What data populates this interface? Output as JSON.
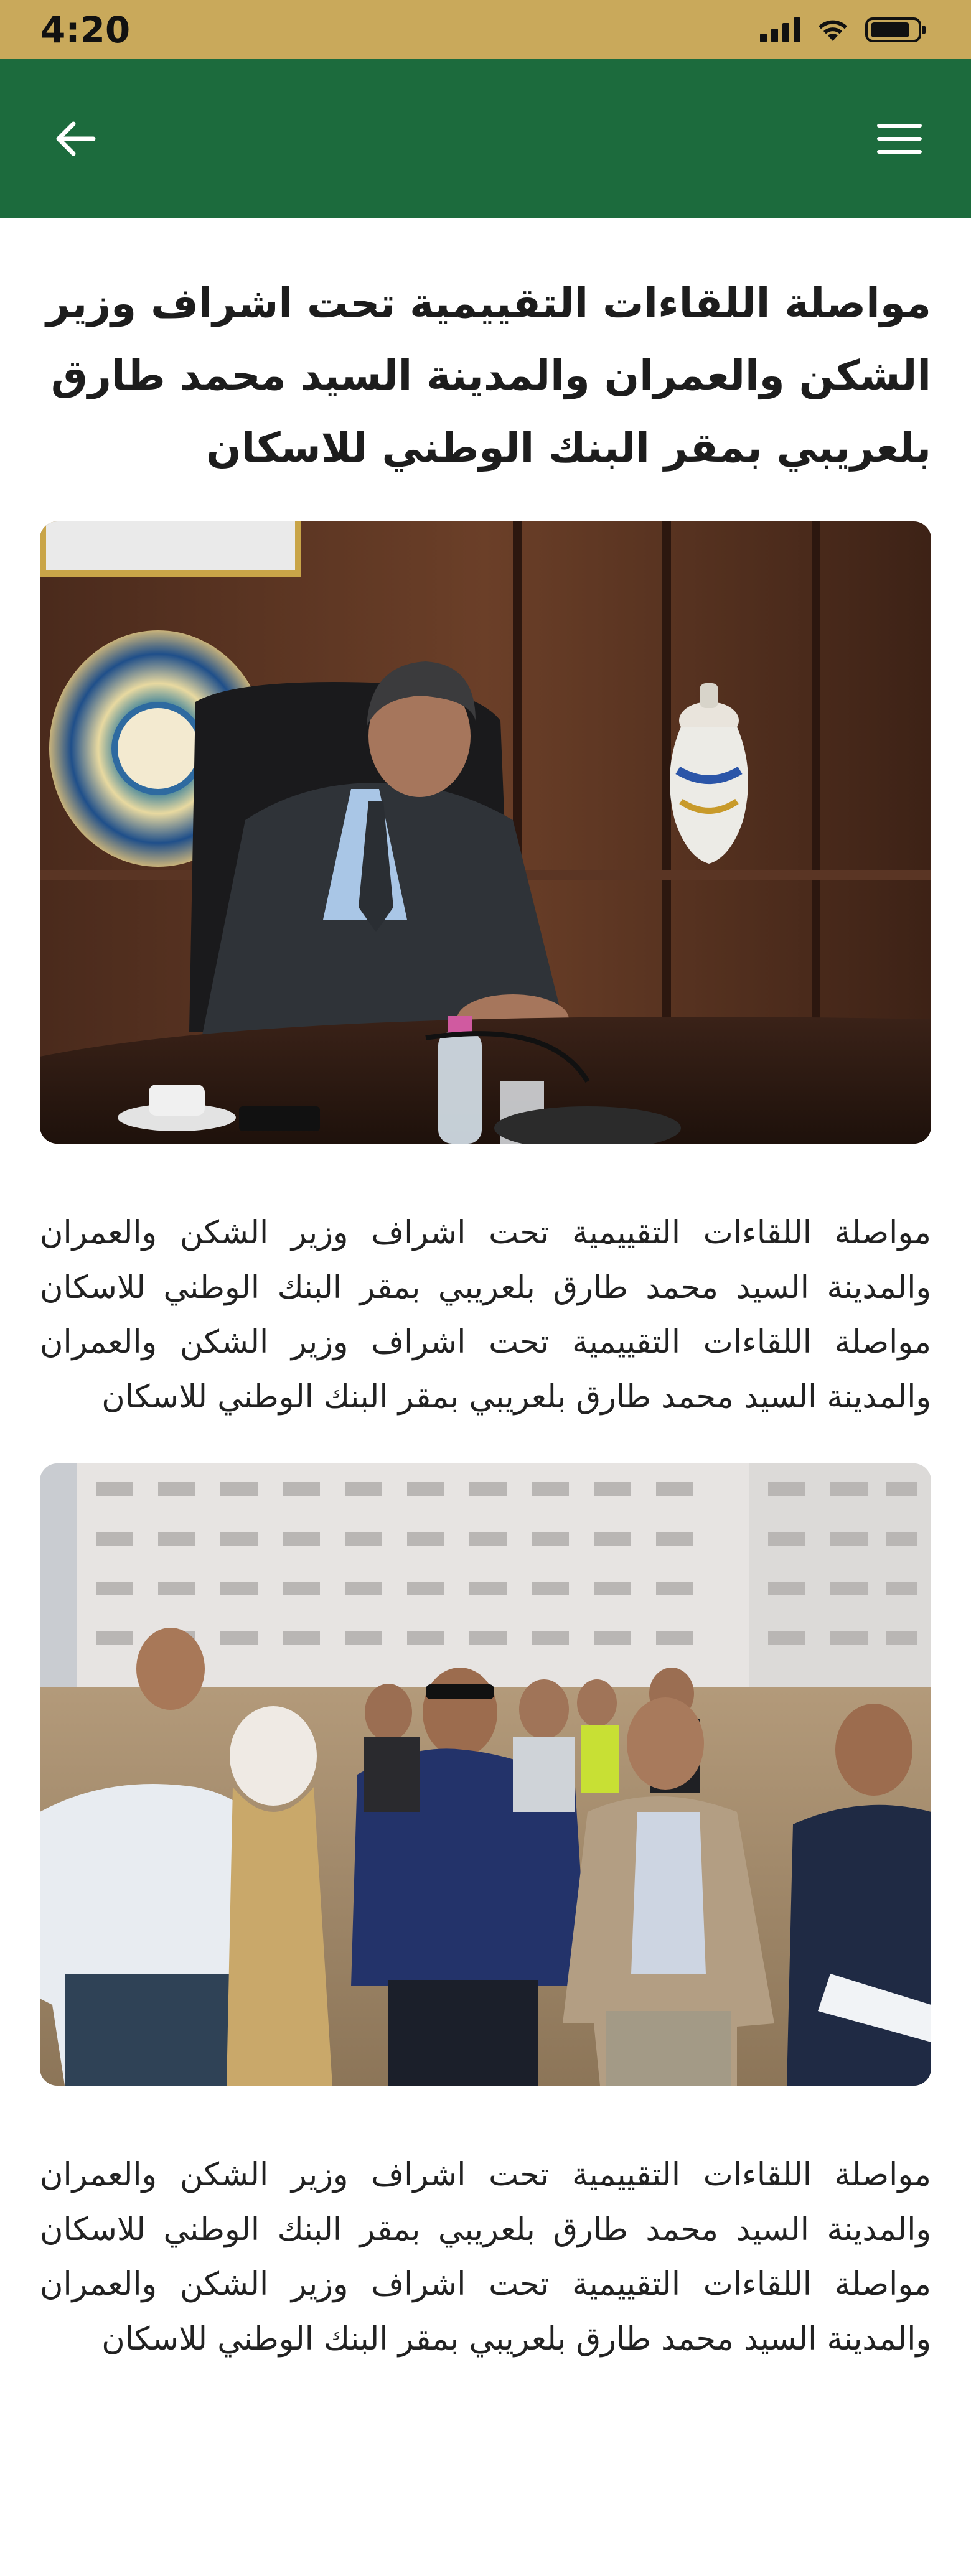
{
  "status_bar": {
    "time": "4:20",
    "icons": [
      "signal-icon",
      "wifi-icon",
      "battery-icon"
    ]
  },
  "app_bar": {
    "back_icon": "arrow-left-icon",
    "menu_icon": "hamburger-menu-icon",
    "background_color": "#1c6b3d"
  },
  "article": {
    "headline": "مواصلة اللقاءات التقييمية تحت اشراف وزير الشكن والعمران والمدينة السيد محمد طارق بلعريبي بمقر البنك الوطني للاسكان",
    "paragraph_1": "مواصلة اللقاءات التقييمية تحت اشراف وزير الشكن والعمران والمدينة السيد محمد طارق بلعريبي بمقر البنك الوطني للاسكان مواصلة اللقاءات التقييمية تحت اشراف وزير الشكن والعمران والمدينة السيد محمد طارق بلعريبي بمقر البنك الوطني للاسكان",
    "paragraph_2": "مواصلة اللقاءات التقييمية تحت اشراف وزير الشكن والعمران والمدينة السيد محمد طارق بلعريبي بمقر البنك الوطني للاسكان مواصلة اللقاءات التقييمية تحت اشراف وزير الشكن والعمران والمدينة السيد محمد طارق بلعريبي بمقر البنك الوطني للاسكان"
  },
  "colors": {
    "status_bar": "#c9a95b",
    "app_bar": "#1c6b3d",
    "text": "#1d1d1d"
  }
}
